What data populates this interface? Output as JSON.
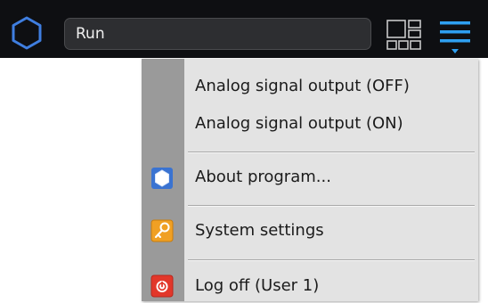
{
  "toolbar": {
    "status": "Run",
    "accent_color": "#2e9ff0",
    "icons": {
      "logo": "hexagon-logo-icon",
      "layout": "grid-layout-icon",
      "menu": "hamburger-menu-icon"
    }
  },
  "menu": {
    "items": [
      {
        "label": "Analog signal output (OFF)"
      },
      {
        "label": "Analog signal output (ON)"
      },
      {
        "label": "About program...",
        "icon": "hexagon-icon"
      },
      {
        "label": "System settings",
        "icon": "key-icon"
      },
      {
        "label": "Log off (User 1)",
        "icon": "power-icon"
      }
    ]
  }
}
